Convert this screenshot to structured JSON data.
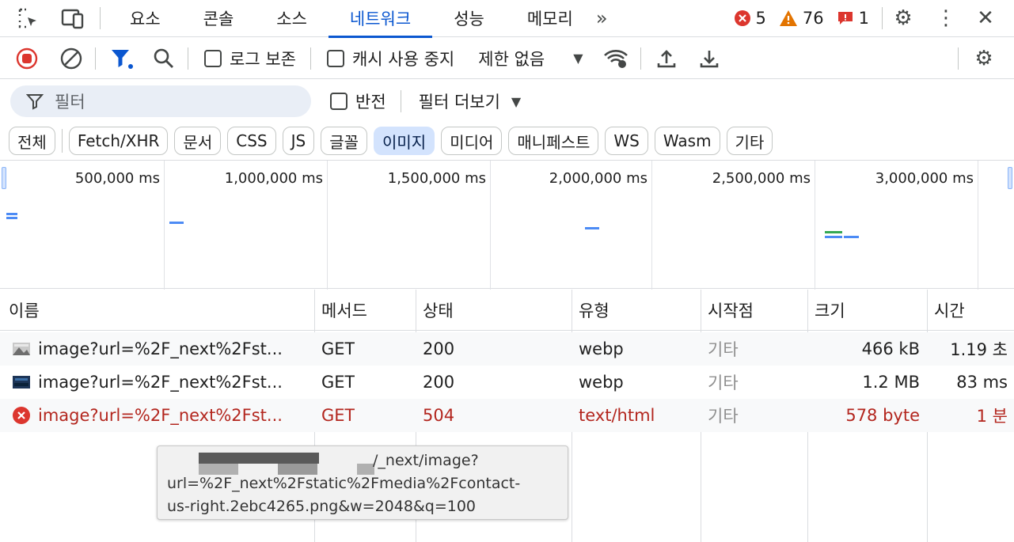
{
  "tabs": [
    "요소",
    "콘솔",
    "소스",
    "네트워크",
    "성능",
    "메모리"
  ],
  "status": {
    "errors": "5",
    "warnings": "76",
    "issues": "1"
  },
  "toolbar": {
    "preserve_log": "로그 보존",
    "disable_cache": "캐시 사용 중지",
    "throttle": "제한 없음"
  },
  "filter": {
    "placeholder": "필터",
    "invert": "반전",
    "more_filters": "필터 더보기"
  },
  "type_filters": [
    "전체",
    "Fetch/XHR",
    "문서",
    "CSS",
    "JS",
    "글꼴",
    "이미지",
    "미디어",
    "매니페스트",
    "WS",
    "Wasm",
    "기타"
  ],
  "active_type": "이미지",
  "overview_ticks": [
    "500,000 ms",
    "1,000,000 ms",
    "1,500,000 ms",
    "2,000,000 ms",
    "2,500,000 ms",
    "3,000,000 ms"
  ],
  "columns": [
    "이름",
    "메서드",
    "상태",
    "유형",
    "시작점",
    "크기",
    "시간"
  ],
  "rows": [
    {
      "name": "image?url=%2F_next%2Fst...",
      "method": "GET",
      "status": "200",
      "type": "webp",
      "initiator": "기타",
      "size": "466 kB",
      "time": "1.19 초",
      "error": false
    },
    {
      "name": "image?url=%2F_next%2Fst...",
      "method": "GET",
      "status": "200",
      "type": "webp",
      "initiator": "기타",
      "size": "1.2 MB",
      "time": "83 ms",
      "error": false
    },
    {
      "name": "image?url=%2F_next%2Fst...",
      "method": "GET",
      "status": "504",
      "type": "text/html",
      "initiator": "기타",
      "size": "578 byte",
      "time": "1 분",
      "error": true
    }
  ],
  "tooltip": {
    "line1": "/_next/image?",
    "line2": "url=%2F_next%2Fstatic%2Fmedia%2Fcontact-",
    "line3": "us-right.2ebc4265.png&w=2048&q=100"
  },
  "colors": {
    "accent": "#0b57d0",
    "error": "#b3261e",
    "warning": "#e37400",
    "waterfall_blue": "#4c8bf5",
    "waterfall_green": "#34a853"
  }
}
